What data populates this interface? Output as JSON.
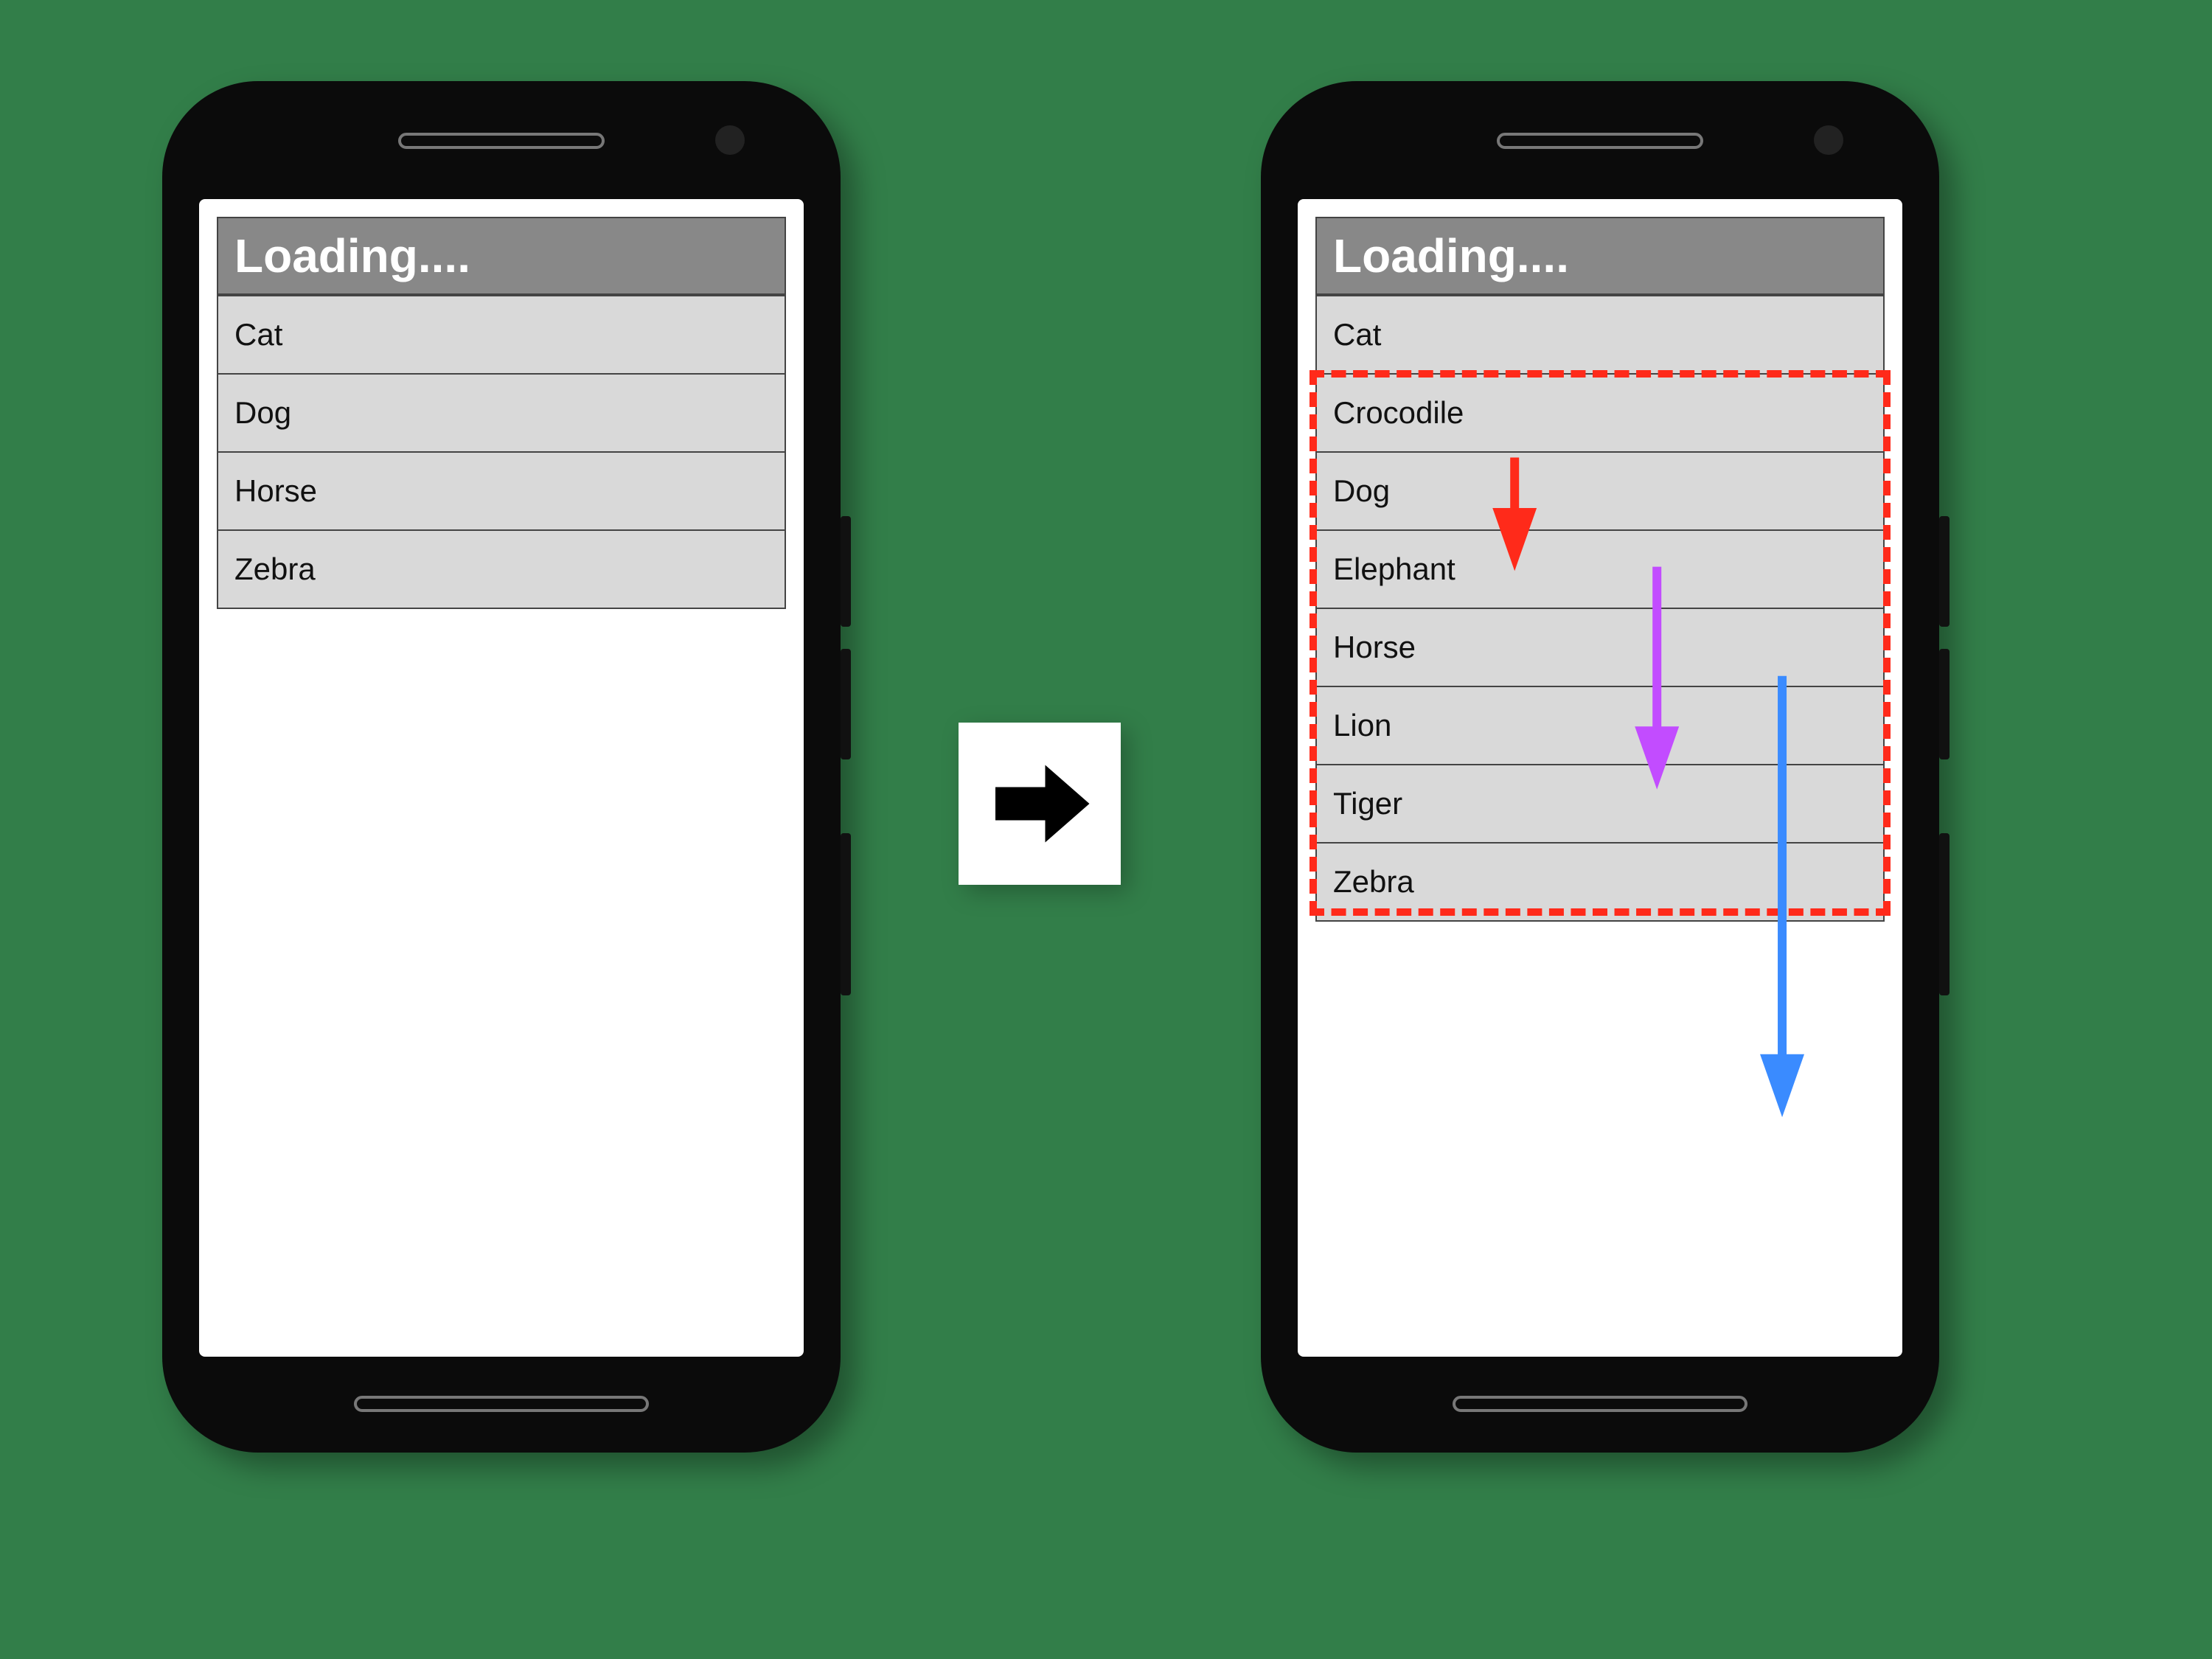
{
  "left_phone": {
    "header": "Loading....",
    "rows": [
      "Cat",
      "Dog",
      "Horse",
      "Zebra"
    ]
  },
  "right_phone": {
    "header": "Loading....",
    "rows": [
      "Cat",
      "Crocodile",
      "Dog",
      "Elephant",
      "Horse",
      "Lion",
      "Tiger",
      "Zebra"
    ],
    "highlight_start_index": 1,
    "highlight_end_index": 7
  },
  "annotation_arrows": [
    {
      "name": "arrow-insert-crocodile",
      "color": "#ff2a1a",
      "from_row": 1,
      "to_row": 2,
      "x_frac": 0.35
    },
    {
      "name": "arrow-insert-elephant",
      "color": "#c24cff",
      "from_row": 2,
      "to_row": 4,
      "x_frac": 0.6
    },
    {
      "name": "arrow-insert-lion-tiger",
      "color": "#3a8bff",
      "from_row": 3,
      "to_row": 7,
      "x_frac": 0.82
    }
  ],
  "transition_icon": "arrow-right"
}
